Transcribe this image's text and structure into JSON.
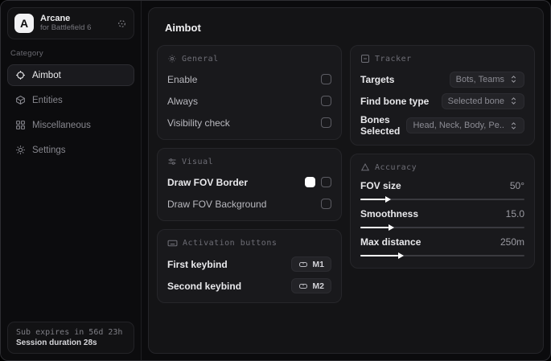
{
  "app": {
    "name": "Arcane",
    "subtitle": "for Battlefield 6",
    "logo_letter": "A"
  },
  "sidebar": {
    "category_label": "Category",
    "items": [
      {
        "label": "Aimbot",
        "icon": "crosshair-icon",
        "active": true
      },
      {
        "label": "Entities",
        "icon": "entities-icon",
        "active": false
      },
      {
        "label": "Miscellaneous",
        "icon": "grid-icon",
        "active": false
      },
      {
        "label": "Settings",
        "icon": "gear-icon",
        "active": false
      }
    ],
    "footer": {
      "sub_expiry": "Sub expires in 56d 23h",
      "session_duration": "Session duration 28s"
    }
  },
  "main": {
    "title": "Aimbot",
    "general": {
      "header": "General",
      "rows": [
        {
          "label": "Enable",
          "checked": false
        },
        {
          "label": "Always",
          "checked": false
        },
        {
          "label": "Visibility check",
          "checked": false
        }
      ]
    },
    "visual": {
      "header": "Visual",
      "rows": [
        {
          "label": "Draw FOV Border",
          "swatch": "#ffffff",
          "checked": false
        },
        {
          "label": "Draw FOV Background",
          "checked": false
        }
      ]
    },
    "activation": {
      "header": "Activation buttons",
      "rows": [
        {
          "label": "First keybind",
          "key": "M1"
        },
        {
          "label": "Second keybind",
          "key": "M2"
        }
      ]
    },
    "tracker": {
      "header": "Tracker",
      "rows": [
        {
          "label": "Targets",
          "value": "Bots, Teams"
        },
        {
          "label": "Find bone type",
          "value": "Selected bone"
        },
        {
          "label": "Bones Selected",
          "value": "Head, Neck, Body, Pe.."
        }
      ]
    },
    "accuracy": {
      "header": "Accuracy",
      "rows": [
        {
          "label": "FOV size",
          "value": "50°",
          "fill_pct": 15
        },
        {
          "label": "Smoothness",
          "value": "15.0",
          "fill_pct": 17
        },
        {
          "label": "Max distance",
          "value": "250m",
          "fill_pct": 23
        }
      ]
    }
  },
  "colors": {
    "accent": "#ffffff",
    "card_bg": "#19191c",
    "panel_bg": "#141416"
  }
}
